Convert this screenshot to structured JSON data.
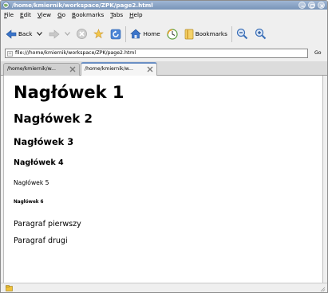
{
  "window": {
    "title": "/home/kmiernik/workspace/ZPK/page2.html"
  },
  "menubar": {
    "items": [
      {
        "first": "F",
        "rest": "ile"
      },
      {
        "first": "E",
        "rest": "dit"
      },
      {
        "first": "V",
        "rest": "iew"
      },
      {
        "first": "G",
        "rest": "o"
      },
      {
        "first": "B",
        "rest": "ookmarks"
      },
      {
        "first": "T",
        "rest": "abs"
      },
      {
        "first": "H",
        "rest": "elp"
      }
    ]
  },
  "toolbar": {
    "back_label": "Back",
    "home_label": "Home",
    "bookmarks_label": "Bookmarks"
  },
  "location": {
    "url": "file:///home/kmiernik/workspace/ZPK/page2.html",
    "go_label": "Go"
  },
  "tabs": [
    {
      "label": "/home/kmiernik/w..."
    },
    {
      "label": "/home/kmiernik/w..."
    }
  ],
  "page": {
    "h1": "Nagłówek 1",
    "h2": "Nagłówek 2",
    "h3": "Nagłówek 3",
    "h4": "Nagłówek 4",
    "h5": "Nagłówek 5",
    "h6": "Nagłówek 6",
    "p1": "Paragraf pierwszy",
    "p2": "Paragraf drugi"
  },
  "colors": {
    "titlebar": "#8aa3c6",
    "accent": "#3a74c9"
  },
  "icons": {
    "app": "browser-globe-icon",
    "back": "back-arrow-icon",
    "forward": "forward-arrow-icon",
    "stop": "stop-icon",
    "bookmark_star": "bookmark-star-icon",
    "reload": "reload-icon",
    "home": "home-icon",
    "history": "history-icon",
    "bookmarks": "bookmarks-icon",
    "zoom_out": "zoom-out-icon",
    "zoom_in": "zoom-in-icon",
    "page": "page-icon",
    "tab_close": "close-icon",
    "status": "status-icon"
  }
}
